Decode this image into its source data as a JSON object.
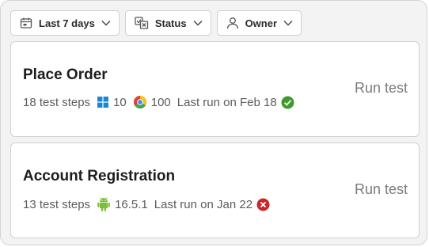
{
  "filters": {
    "date": "Last 7 days",
    "status": "Status",
    "owner": "Owner"
  },
  "tests": [
    {
      "title": "Place Order",
      "steps": "18 test steps",
      "windows_version": "10",
      "chrome_version": "100",
      "last_run": "Last run on Feb 18",
      "result": "passed",
      "run_label": "Run test"
    },
    {
      "title": "Account Registration",
      "steps": "13 test steps",
      "android_version": "16.5.1",
      "last_run": "Last run on Jan 22",
      "result": "failed",
      "run_label": "Run test"
    }
  ],
  "colors": {
    "pass": "#3c9b2a",
    "fail": "#c8272d",
    "windows": "#1a87d6",
    "android": "#7cbd3a"
  }
}
